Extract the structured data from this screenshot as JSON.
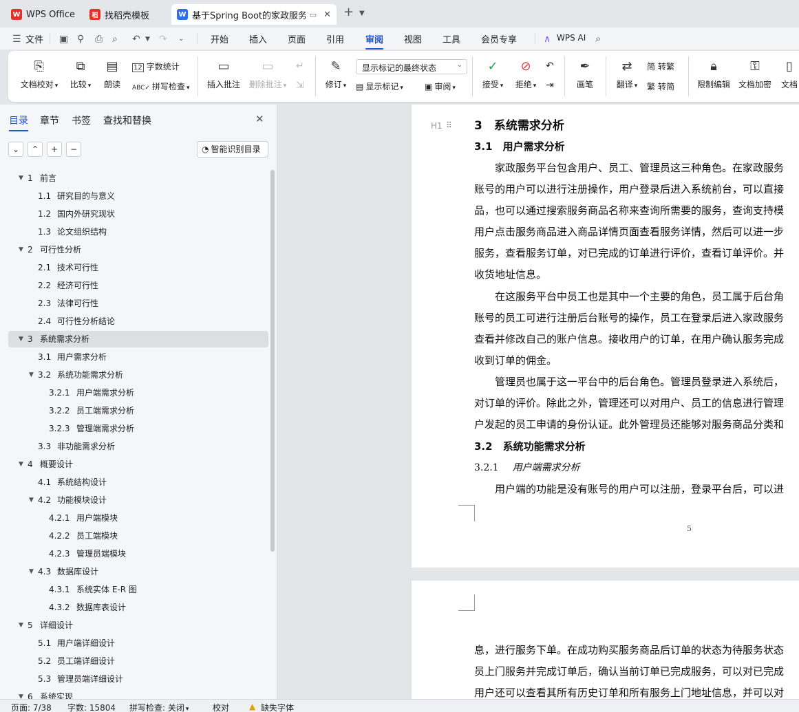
{
  "tabs": [
    {
      "label": "WPS Office",
      "logo": "W"
    },
    {
      "label": "找稻壳模板",
      "logo": "稻"
    },
    {
      "label": "基于Spring Boot的家政服务平",
      "logo": "W"
    }
  ],
  "menu": {
    "file": "文件",
    "items": [
      "开始",
      "插入",
      "页面",
      "引用",
      "审阅",
      "视图",
      "工具",
      "会员专享"
    ],
    "active": "审阅",
    "ai": "WPS AI"
  },
  "ribbon": {
    "doc_check": "文档校对",
    "compare": "比较",
    "read_aloud": "朗读",
    "word_count": "字数统计",
    "spell_check": "拼写检查",
    "insert_comment": "插入批注",
    "delete_comment": "删除批注",
    "track": "修订",
    "display_mode": "显示标记的最终状态",
    "show_markup": "显示标记",
    "review": "审阅",
    "accept": "接受",
    "reject": "拒绝",
    "pen": "画笔",
    "translate": "翻译",
    "to_traditional": "转繁",
    "to_simplified": "转简",
    "restrict_edit": "限制编辑",
    "encrypt": "文档加密",
    "doc_more": "文档"
  },
  "sidebar": {
    "tabs": [
      "目录",
      "章节",
      "书签",
      "查找和替换"
    ],
    "smart_toc": "智能识别目录",
    "toc": [
      {
        "num": "1",
        "text": "前言",
        "level": 1,
        "expanded": true
      },
      {
        "num": "1.1",
        "text": "研究目的与意义",
        "level": 2
      },
      {
        "num": "1.2",
        "text": "国内外研究现状",
        "level": 2
      },
      {
        "num": "1.3",
        "text": "论文组织结构",
        "level": 2
      },
      {
        "num": "2",
        "text": "可行性分析",
        "level": 1,
        "expanded": true
      },
      {
        "num": "2.1",
        "text": "技术可行性",
        "level": 2
      },
      {
        "num": "2.2",
        "text": "经济可行性",
        "level": 2
      },
      {
        "num": "2.3",
        "text": "法律可行性",
        "level": 2
      },
      {
        "num": "2.4",
        "text": "可行性分析结论",
        "level": 2
      },
      {
        "num": "3",
        "text": "系统需求分析",
        "level": 1,
        "expanded": true,
        "selected": true
      },
      {
        "num": "3.1",
        "text": "用户需求分析",
        "level": 2
      },
      {
        "num": "3.2",
        "text": "系统功能需求分析",
        "level": 2,
        "expanded": true
      },
      {
        "num": "3.2.1",
        "text": "用户端需求分析",
        "level": 3
      },
      {
        "num": "3.2.2",
        "text": "员工端需求分析",
        "level": 3
      },
      {
        "num": "3.2.3",
        "text": "管理端需求分析",
        "level": 3
      },
      {
        "num": "3.3",
        "text": "非功能需求分析",
        "level": 2
      },
      {
        "num": "4",
        "text": "概要设计",
        "level": 1,
        "expanded": true
      },
      {
        "num": "4.1",
        "text": "系统结构设计",
        "level": 2
      },
      {
        "num": "4.2",
        "text": "功能模块设计",
        "level": 2,
        "expanded": true
      },
      {
        "num": "4.2.1",
        "text": "用户端模块",
        "level": 3
      },
      {
        "num": "4.2.2",
        "text": "员工端模块",
        "level": 3
      },
      {
        "num": "4.2.3",
        "text": "管理员端模块",
        "level": 3
      },
      {
        "num": "4.3",
        "text": "数据库设计",
        "level": 2,
        "expanded": true
      },
      {
        "num": "4.3.1",
        "text": "系统实体 E-R 图",
        "level": 3
      },
      {
        "num": "4.3.2",
        "text": "数据库表设计",
        "level": 3
      },
      {
        "num": "5",
        "text": "详细设计",
        "level": 1,
        "expanded": true
      },
      {
        "num": "5.1",
        "text": "用户端详细设计",
        "level": 2
      },
      {
        "num": "5.2",
        "text": "员工端详细设计",
        "level": 2
      },
      {
        "num": "5.3",
        "text": "管理员端详细设计",
        "level": 2
      },
      {
        "num": "6",
        "text": "系统实现",
        "level": 1,
        "expanded": true
      }
    ]
  },
  "document": {
    "heading_marker": "H1",
    "h1": "3　系统需求分析",
    "h2_1": "3.1　用户需求分析",
    "p1": [
      "　　家政服务平台包含用户、员工、管理员这三种角色。在家政服务",
      "账号的用户可以进行注册操作，用户登录后进入系统前台，可以直接",
      "品，也可以通过搜索服务商品名称来查询所需要的服务，查询支持模",
      "用户点击服务商品进入商品详情页面查看服务详情，然后可以进一步",
      "服务，查看服务订单，对已完成的订单进行评价，查看订单评价。并",
      "收货地址信息。"
    ],
    "p2": [
      "　　在这服务平台中员工也是其中一个主要的角色，员工属于后台角",
      "账号的员工可进行注册后台账号的操作，员工在登录后进入家政服务",
      "查看并修改自己的账户信息。接收用户的订单，在用户确认服务完成",
      "收到订单的佣金。"
    ],
    "p3": [
      "　　管理员也属于这一平台中的后台角色。管理员登录进入系统后，",
      "对订单的评价。除此之外，管理还可以对用户、员工的信息进行管理",
      "户发起的员工申请的身份认证。此外管理员还能够对服务商品分类和"
    ],
    "h2_2": "3.2　系统功能需求分析",
    "h3_num": "3.2.1",
    "h3_text": "用户端需求分析",
    "p4": "　　用户端的功能是没有账号的用户可以注册，登录平台后，可以进",
    "page_number": "5",
    "next_page": [
      "息，进行服务下单。在成功购买服务商品后订单的状态为待服务状态",
      "员上门服务并完成订单后，确认当前订单已完成服务，可以对已完成",
      "用户还可以查看其所有历史订单和所有服务上门地址信息，并可以对"
    ]
  },
  "status": {
    "page": "页面: 7/38",
    "words": "字数: 15804",
    "spell": "拼写检查: 关闭",
    "proof": "校对",
    "missing_font": "缺失字体"
  },
  "colors": {
    "accent": "#1a56d6",
    "wps_red": "#e0322a",
    "doc_blue": "#2f6ee6"
  }
}
